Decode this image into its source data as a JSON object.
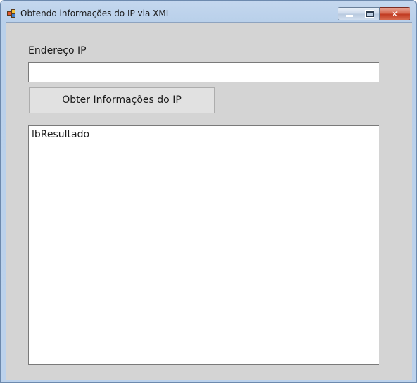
{
  "window": {
    "title": "Obtendo informações do IP via XML",
    "icon": "winforms-app-icon",
    "controls": {
      "minimize": "minimize-icon",
      "maximize": "maximize-icon",
      "close_label": "✕"
    }
  },
  "form": {
    "ip_label": "Endereço IP",
    "ip_input": {
      "value": "",
      "placeholder": ""
    },
    "button_label": "Obter Informações do IP",
    "result_label": "lbResultado"
  },
  "colors": {
    "client_background": "#d4d4d4",
    "titlebar": "#bcd2ec",
    "close_button": "#c13b22"
  }
}
